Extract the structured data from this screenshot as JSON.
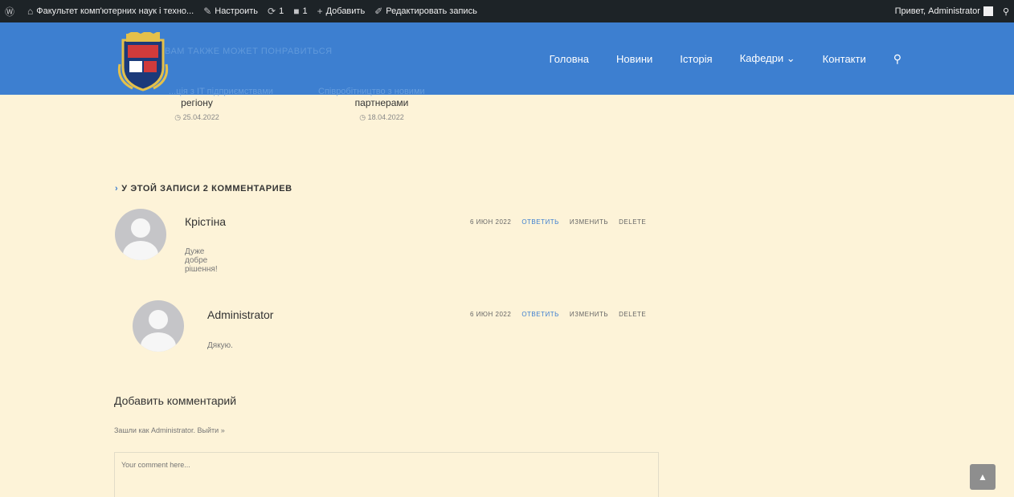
{
  "adminbar": {
    "wp_logo": "wordpress-icon",
    "site_name": "Факультет комп'ютерних наук і техно...",
    "customize": "Настроить",
    "updates_count": "1",
    "comments_count": "1",
    "add_new": "Добавить",
    "edit_post": "Редактировать запись",
    "greeting": "Привет, Administrator"
  },
  "header": {
    "nav": [
      "Головна",
      "Новини",
      "Історія",
      "Кафедри",
      "Контакти"
    ],
    "behind_text": "Вам также может понравиться",
    "accent_color": "#3d7fd0"
  },
  "related": [
    {
      "title_top": "...ція з IT підприємствами",
      "title": "регіону",
      "date": "25.04.2022"
    },
    {
      "title_top": "Співробітництво з новими",
      "title": "партнерами",
      "date": "18.04.2022"
    }
  ],
  "comments": {
    "heading": "У этой записи 2 комментариев",
    "items": [
      {
        "author": "Крістіна",
        "text": "Дуже добре рішення!",
        "date": "6 июн 2022",
        "reply": "ответить",
        "edit": "изменить",
        "delete": "delete"
      },
      {
        "author": "Administrator",
        "text": "Дякую.",
        "date": "6 июн 2022",
        "reply": "ответить",
        "edit": "изменить",
        "delete": "delete"
      }
    ]
  },
  "form": {
    "title": "Добавить комментарий",
    "logged_as": "Зашли как Administrator. Выйти »",
    "placeholder": "Your comment here..."
  },
  "background_color": "#fdf3d8"
}
